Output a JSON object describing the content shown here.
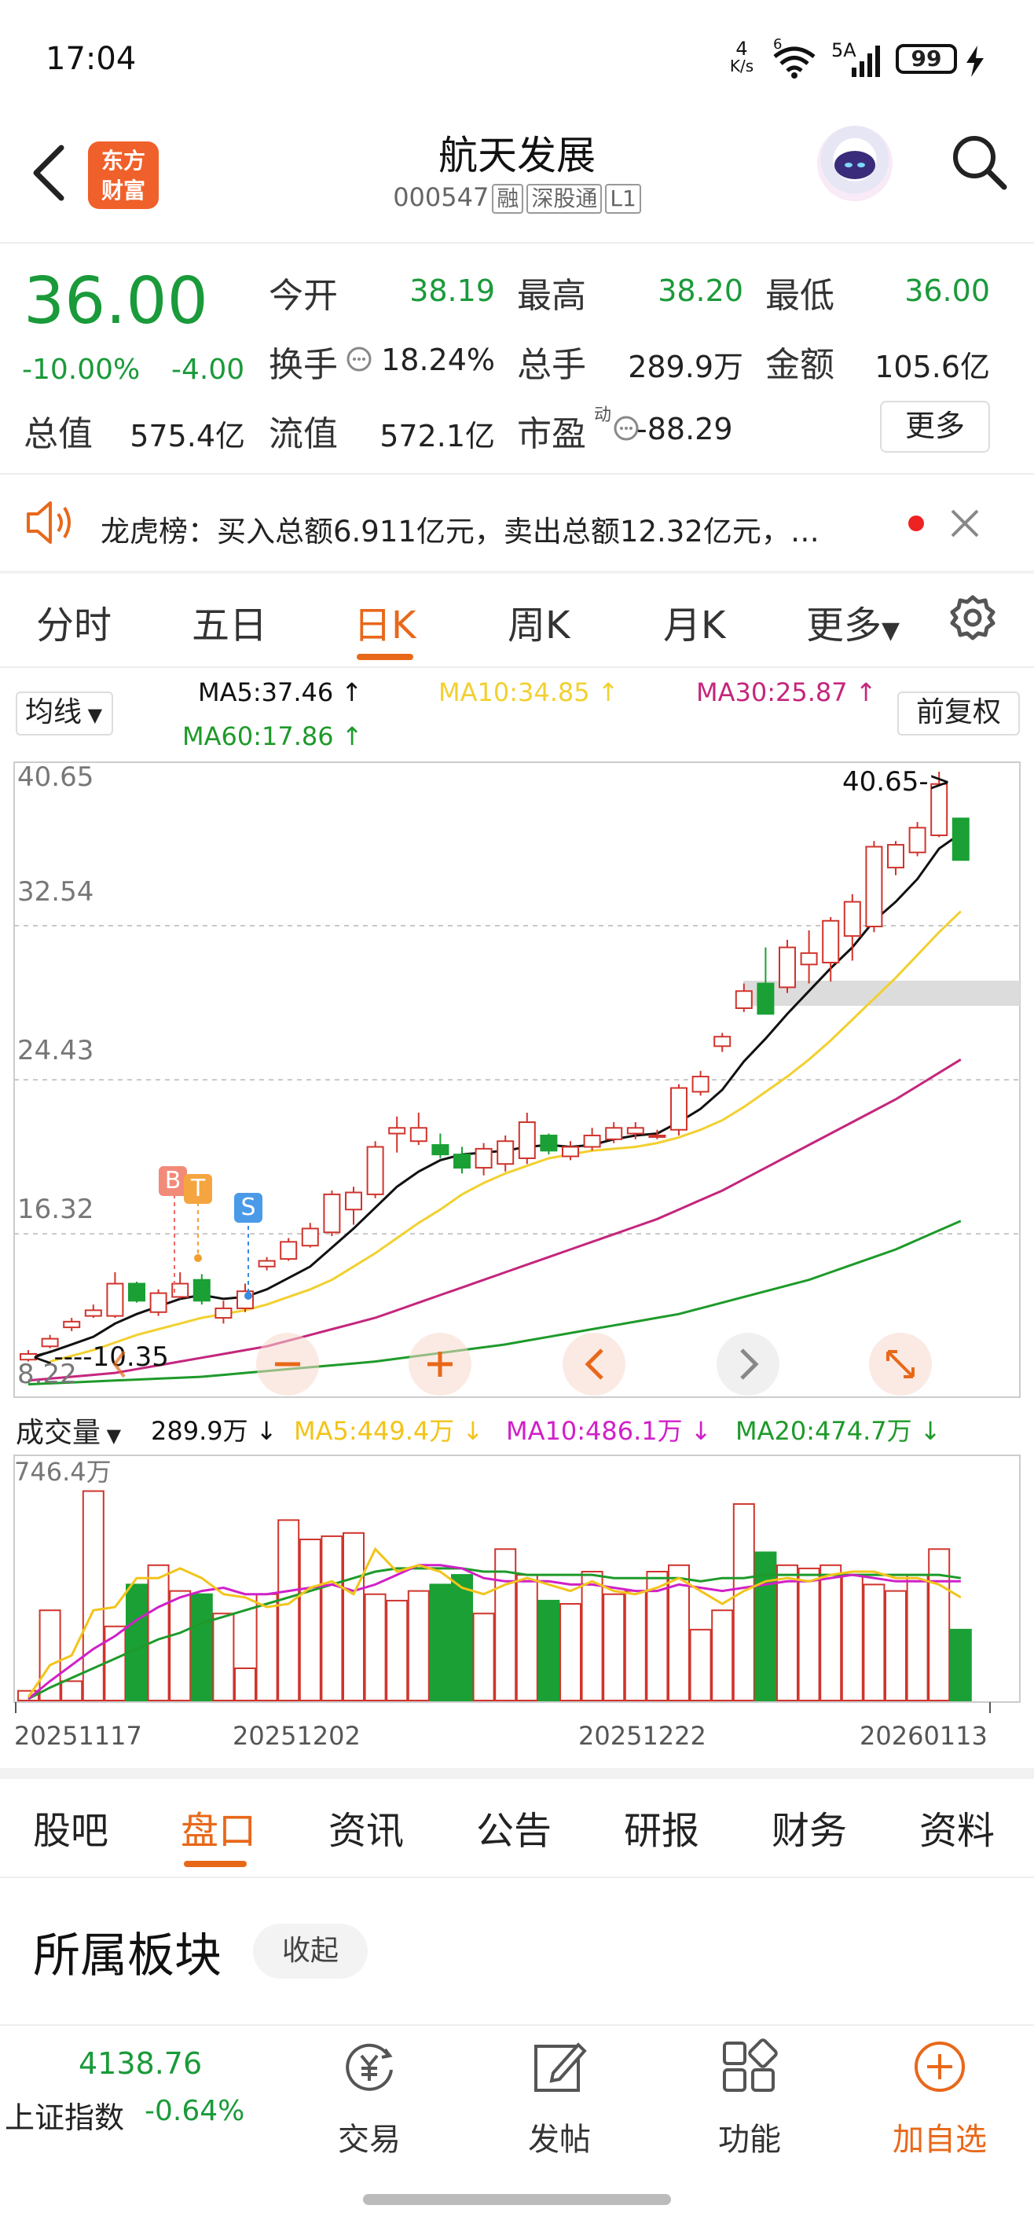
{
  "status_bar": {
    "time": "17:04",
    "net_speed_top": "4",
    "net_speed_unit": "K/s",
    "wifi_tag": "6",
    "signal_tag": "5A",
    "battery": "99"
  },
  "header": {
    "stock_name": "航天发展",
    "stock_code": "000547",
    "tags": [
      "融",
      "深股通",
      "L1"
    ],
    "logo_line1": "东方",
    "logo_line2": "财富"
  },
  "quote": {
    "price": "36.00",
    "pct_change": "-10.00%",
    "change": "-4.00",
    "open_label": "今开",
    "open": "38.19",
    "high_label": "最高",
    "high": "38.20",
    "low_label": "最低",
    "low": "36.00",
    "turnover_label": "换手",
    "turnover": "18.24%",
    "volume_label": "总手",
    "volume": "289.9万",
    "amount_label": "金额",
    "amount": "105.6亿",
    "mcap_label": "总值",
    "mcap": "575.4亿",
    "float_label": "流值",
    "float_cap": "572.1亿",
    "pe_label": "市盈",
    "pe_sup": "动",
    "pe": "-88.29",
    "more_label": "更多"
  },
  "news": {
    "text": "龙虎榜：买入总额6.911亿元，卖出总额12.32亿元，…"
  },
  "period_tabs": [
    "分时",
    "五日",
    "日K",
    "周K",
    "月K",
    "更多"
  ],
  "ma_legend": {
    "select": "均线",
    "ma5": "MA5:37.46",
    "ma10": "MA10:34.85",
    "ma30": "MA30:25.87",
    "ma60": "MA60:17.86",
    "adjust": "前复权"
  },
  "colors": {
    "up": "#d0342c",
    "down": "#1aa035",
    "ma5": "#111111",
    "ma10": "#f2d030",
    "ma30": "#c4267d",
    "ma60": "#1e9a2a",
    "accent": "#e8681a"
  },
  "kline_axis": {
    "y_labels": [
      "40.65",
      "32.54",
      "24.43",
      "16.32",
      "8.22"
    ],
    "max_marker": "40.65->",
    "min_marker": "<----10.35",
    "signals": [
      "B",
      "T",
      "S"
    ]
  },
  "volume_legend": {
    "select": "成交量",
    "vol": "289.9万",
    "ma5": "MA5:449.4万",
    "ma10": "MA10:486.1万",
    "ma20": "MA20:474.7万",
    "y_max": "746.4万"
  },
  "dates": [
    "20251117",
    "20251202",
    "20251222",
    "20260113"
  ],
  "chart_data": {
    "type": "candlestick",
    "y_range": [
      8.22,
      40.65
    ],
    "candles": [
      {
        "o": 9.7,
        "c": 10.0,
        "h": 10.2,
        "l": 9.6
      },
      {
        "o": 10.4,
        "c": 10.8,
        "h": 11.0,
        "l": 10.3
      },
      {
        "o": 11.4,
        "c": 11.7,
        "h": 11.9,
        "l": 11.2
      },
      {
        "o": 12.0,
        "c": 12.3,
        "h": 12.6,
        "l": 11.9
      },
      {
        "o": 12.0,
        "c": 13.7,
        "h": 14.3,
        "l": 11.9
      },
      {
        "o": 13.7,
        "c": 12.8,
        "h": 13.8,
        "l": 12.7
      },
      {
        "o": 12.2,
        "c": 13.2,
        "h": 13.4,
        "l": 12.0
      },
      {
        "o": 13.0,
        "c": 13.7,
        "h": 14.3,
        "l": 12.9
      },
      {
        "o": 13.9,
        "c": 12.8,
        "h": 14.2,
        "l": 12.6
      },
      {
        "o": 11.9,
        "c": 12.4,
        "h": 12.8,
        "l": 11.6
      },
      {
        "o": 12.4,
        "c": 13.3,
        "h": 13.7,
        "l": 12.2
      },
      {
        "o": 14.6,
        "c": 14.9,
        "h": 15.1,
        "l": 14.4
      },
      {
        "o": 15.0,
        "c": 15.9,
        "h": 16.1,
        "l": 14.9
      },
      {
        "o": 15.7,
        "c": 16.6,
        "h": 16.9,
        "l": 15.6
      },
      {
        "o": 16.4,
        "c": 18.4,
        "h": 18.6,
        "l": 16.2
      },
      {
        "o": 17.6,
        "c": 18.5,
        "h": 18.8,
        "l": 16.8
      },
      {
        "o": 18.4,
        "c": 20.9,
        "h": 21.2,
        "l": 18.2
      },
      {
        "o": 21.6,
        "c": 21.9,
        "h": 22.5,
        "l": 20.6
      },
      {
        "o": 21.2,
        "c": 21.9,
        "h": 22.7,
        "l": 21.0
      },
      {
        "o": 21.0,
        "c": 20.5,
        "h": 21.6,
        "l": 20.3
      },
      {
        "o": 20.5,
        "c": 19.8,
        "h": 20.9,
        "l": 19.5
      },
      {
        "o": 19.8,
        "c": 20.8,
        "h": 21.1,
        "l": 19.4
      },
      {
        "o": 20.0,
        "c": 21.2,
        "h": 21.5,
        "l": 19.6
      },
      {
        "o": 20.3,
        "c": 22.2,
        "h": 22.7,
        "l": 20.0
      },
      {
        "o": 21.5,
        "c": 20.7,
        "h": 21.6,
        "l": 20.5
      },
      {
        "o": 20.4,
        "c": 20.9,
        "h": 21.2,
        "l": 20.2
      },
      {
        "o": 20.9,
        "c": 21.5,
        "h": 21.9,
        "l": 20.7
      },
      {
        "o": 21.3,
        "c": 21.9,
        "h": 22.2,
        "l": 21.1
      },
      {
        "o": 21.6,
        "c": 21.9,
        "h": 22.2,
        "l": 21.3
      },
      {
        "o": 21.5,
        "c": 21.5,
        "h": 21.8,
        "l": 21.3
      },
      {
        "o": 21.8,
        "c": 24.0,
        "h": 24.2,
        "l": 21.5
      },
      {
        "o": 23.8,
        "c": 24.6,
        "h": 24.9,
        "l": 23.6
      },
      {
        "o": 26.2,
        "c": 26.7,
        "h": 26.9,
        "l": 25.9
      },
      {
        "o": 28.2,
        "c": 29.1,
        "h": 29.5,
        "l": 28.0
      },
      {
        "o": 29.5,
        "c": 27.9,
        "h": 31.4,
        "l": 27.9
      },
      {
        "o": 29.3,
        "c": 31.4,
        "h": 31.8,
        "l": 29.0
      },
      {
        "o": 30.5,
        "c": 31.1,
        "h": 32.3,
        "l": 29.5
      },
      {
        "o": 30.6,
        "c": 32.8,
        "h": 33.0,
        "l": 29.6
      },
      {
        "o": 32.0,
        "c": 33.8,
        "h": 34.2,
        "l": 30.7
      },
      {
        "o": 32.5,
        "c": 36.7,
        "h": 37.0,
        "l": 32.2
      },
      {
        "o": 35.6,
        "c": 36.8,
        "h": 37.0,
        "l": 35.2
      },
      {
        "o": 36.4,
        "c": 37.7,
        "h": 38.0,
        "l": 36.2
      },
      {
        "o": 37.3,
        "c": 40.0,
        "h": 40.65,
        "l": 37.2
      },
      {
        "o": 38.19,
        "c": 36.0,
        "h": 38.2,
        "l": 36.0
      }
    ],
    "ma5": [
      9.8,
      10.1,
      10.5,
      10.9,
      11.6,
      12.1,
      12.5,
      12.9,
      13.1,
      12.9,
      13.0,
      13.4,
      14.0,
      14.6,
      15.6,
      16.6,
      17.7,
      18.8,
      19.6,
      20.2,
      20.5,
      20.6,
      20.7,
      20.9,
      21.0,
      20.9,
      21.0,
      21.3,
      21.5,
      21.6,
      22.2,
      22.9,
      23.9,
      25.4,
      26.6,
      27.9,
      29.1,
      30.3,
      31.4,
      32.8,
      33.8,
      35.0,
      36.6,
      37.4
    ],
    "ma10": [
      null,
      9.6,
      9.9,
      10.2,
      10.6,
      11.0,
      11.3,
      11.6,
      11.9,
      12.1,
      12.3,
      12.6,
      13.0,
      13.4,
      13.9,
      14.6,
      15.3,
      16.1,
      16.9,
      17.6,
      18.4,
      19.0,
      19.5,
      19.9,
      20.3,
      20.5,
      20.7,
      20.8,
      20.9,
      21.1,
      21.4,
      21.8,
      22.3,
      23.0,
      23.8,
      24.6,
      25.5,
      26.5,
      27.6,
      28.7,
      29.8,
      31.0,
      32.2,
      33.3
    ],
    "ma30": [
      8.6,
      8.7,
      8.8,
      8.9,
      9.0,
      9.2,
      9.4,
      9.6,
      9.8,
      10.0,
      10.2,
      10.4,
      10.7,
      11.0,
      11.3,
      11.6,
      11.9,
      12.3,
      12.7,
      13.1,
      13.5,
      13.9,
      14.3,
      14.7,
      15.1,
      15.5,
      15.9,
      16.3,
      16.7,
      17.1,
      17.6,
      18.1,
      18.6,
      19.2,
      19.8,
      20.4,
      21.0,
      21.6,
      22.2,
      22.8,
      23.4,
      24.1,
      24.8,
      25.5
    ],
    "ma60": [
      8.4,
      8.45,
      8.5,
      8.55,
      8.6,
      8.65,
      8.7,
      8.75,
      8.8,
      8.9,
      9.0,
      9.1,
      9.2,
      9.3,
      9.4,
      9.5,
      9.6,
      9.75,
      9.9,
      10.05,
      10.2,
      10.35,
      10.5,
      10.7,
      10.9,
      11.1,
      11.3,
      11.5,
      11.7,
      11.9,
      12.1,
      12.4,
      12.7,
      13.0,
      13.3,
      13.6,
      13.9,
      14.3,
      14.7,
      15.1,
      15.5,
      16.0,
      16.5,
      17.0
    ],
    "volume_wan": [
      30,
      280,
      60,
      650,
      230,
      360,
      420,
      340,
      330,
      270,
      100,
      330,
      560,
      500,
      510,
      520,
      330,
      310,
      340,
      360,
      390,
      270,
      470,
      390,
      310,
      300,
      400,
      330,
      340,
      400,
      420,
      220,
      280,
      610,
      460,
      420,
      410,
      420,
      390,
      360,
      340,
      390,
      470,
      220
    ],
    "volume_ma5": [
      10,
      110,
      140,
      280,
      290,
      380,
      380,
      410,
      380,
      330,
      320,
      290,
      300,
      350,
      370,
      330,
      470,
      400,
      420,
      400,
      350,
      330,
      360,
      380,
      360,
      340,
      370,
      340,
      330,
      350,
      380,
      340,
      300,
      340,
      370,
      380,
      370,
      390,
      400,
      400,
      380,
      380,
      360,
      320
    ],
    "volume_ma10": [
      5,
      60,
      110,
      160,
      200,
      250,
      290,
      320,
      340,
      350,
      330,
      330,
      340,
      350,
      360,
      340,
      360,
      390,
      420,
      420,
      410,
      380,
      370,
      370,
      370,
      360,
      360,
      350,
      340,
      340,
      360,
      350,
      340,
      350,
      360,
      370,
      370,
      380,
      390,
      380,
      370,
      370,
      370,
      370
    ],
    "volume_ma20": [
      5,
      40,
      70,
      100,
      130,
      160,
      190,
      210,
      240,
      260,
      280,
      300,
      320,
      340,
      360,
      380,
      400,
      410,
      410,
      410,
      410,
      400,
      400,
      390,
      390,
      390,
      390,
      380,
      380,
      380,
      380,
      370,
      380,
      380,
      390,
      390,
      390,
      390,
      390,
      390,
      390,
      390,
      390,
      380
    ],
    "volume_y_max": 746.4
  },
  "section_tabs": [
    "股吧",
    "盘口",
    "资讯",
    "公告",
    "研报",
    "财务",
    "资料"
  ],
  "section": {
    "title": "所属板块",
    "collapse": "收起"
  },
  "bottom_nav": {
    "index_value": "4138.76",
    "index_name": "上证指数",
    "index_change": "-0.64%",
    "items": [
      "交易",
      "发帖",
      "功能",
      "加自选"
    ]
  }
}
